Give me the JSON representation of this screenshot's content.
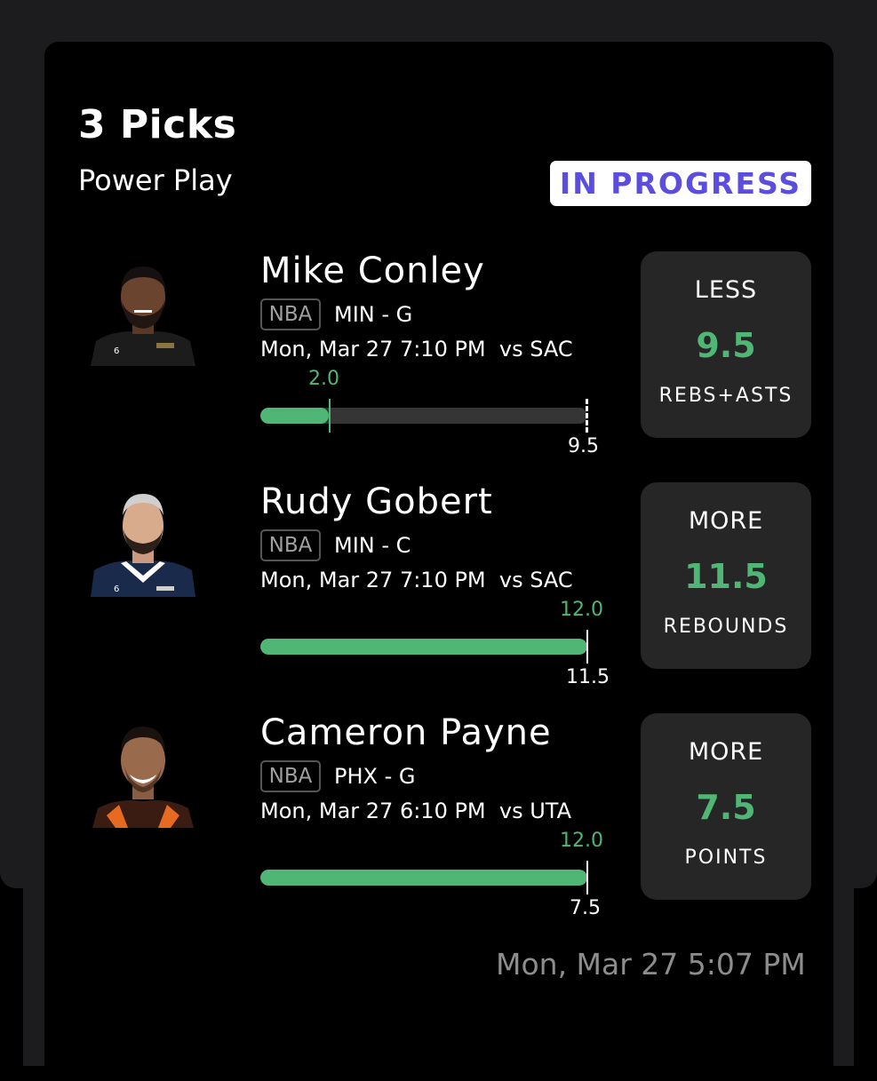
{
  "header": {
    "title": "3 Picks",
    "subtitle": "Power Play",
    "status": "IN PROGRESS"
  },
  "colors": {
    "accent_green": "#4fb675",
    "status_purple": "#5b4ddf",
    "card_bg": "#000000",
    "panel_bg": "#262626"
  },
  "picks": [
    {
      "player": "Mike Conley",
      "league": "NBA",
      "team_pos": "MIN - G",
      "game": "Mon, Mar 27 7:10 PM  vs SAC",
      "current": "2.0",
      "line": "9.5",
      "progress_fraction": 0.21,
      "direction": "LESS",
      "line_value": "9.5",
      "stat": "REBS+ASTS"
    },
    {
      "player": "Rudy Gobert",
      "league": "NBA",
      "team_pos": "MIN - C",
      "game": "Mon, Mar 27 7:10 PM  vs SAC",
      "current": "12.0",
      "line": "11.5",
      "progress_fraction": 1.0,
      "direction": "MORE",
      "line_value": "11.5",
      "stat": "REBOUNDS"
    },
    {
      "player": "Cameron Payne",
      "league": "NBA",
      "team_pos": "PHX - G",
      "game": "Mon, Mar 27 6:10 PM  vs UTA",
      "current": "12.0",
      "line": "7.5",
      "progress_fraction": 1.0,
      "direction": "MORE",
      "line_value": "7.5",
      "stat": "POINTS"
    }
  ],
  "footer": {
    "timestamp": "Mon, Mar 27 5:07 PM"
  }
}
